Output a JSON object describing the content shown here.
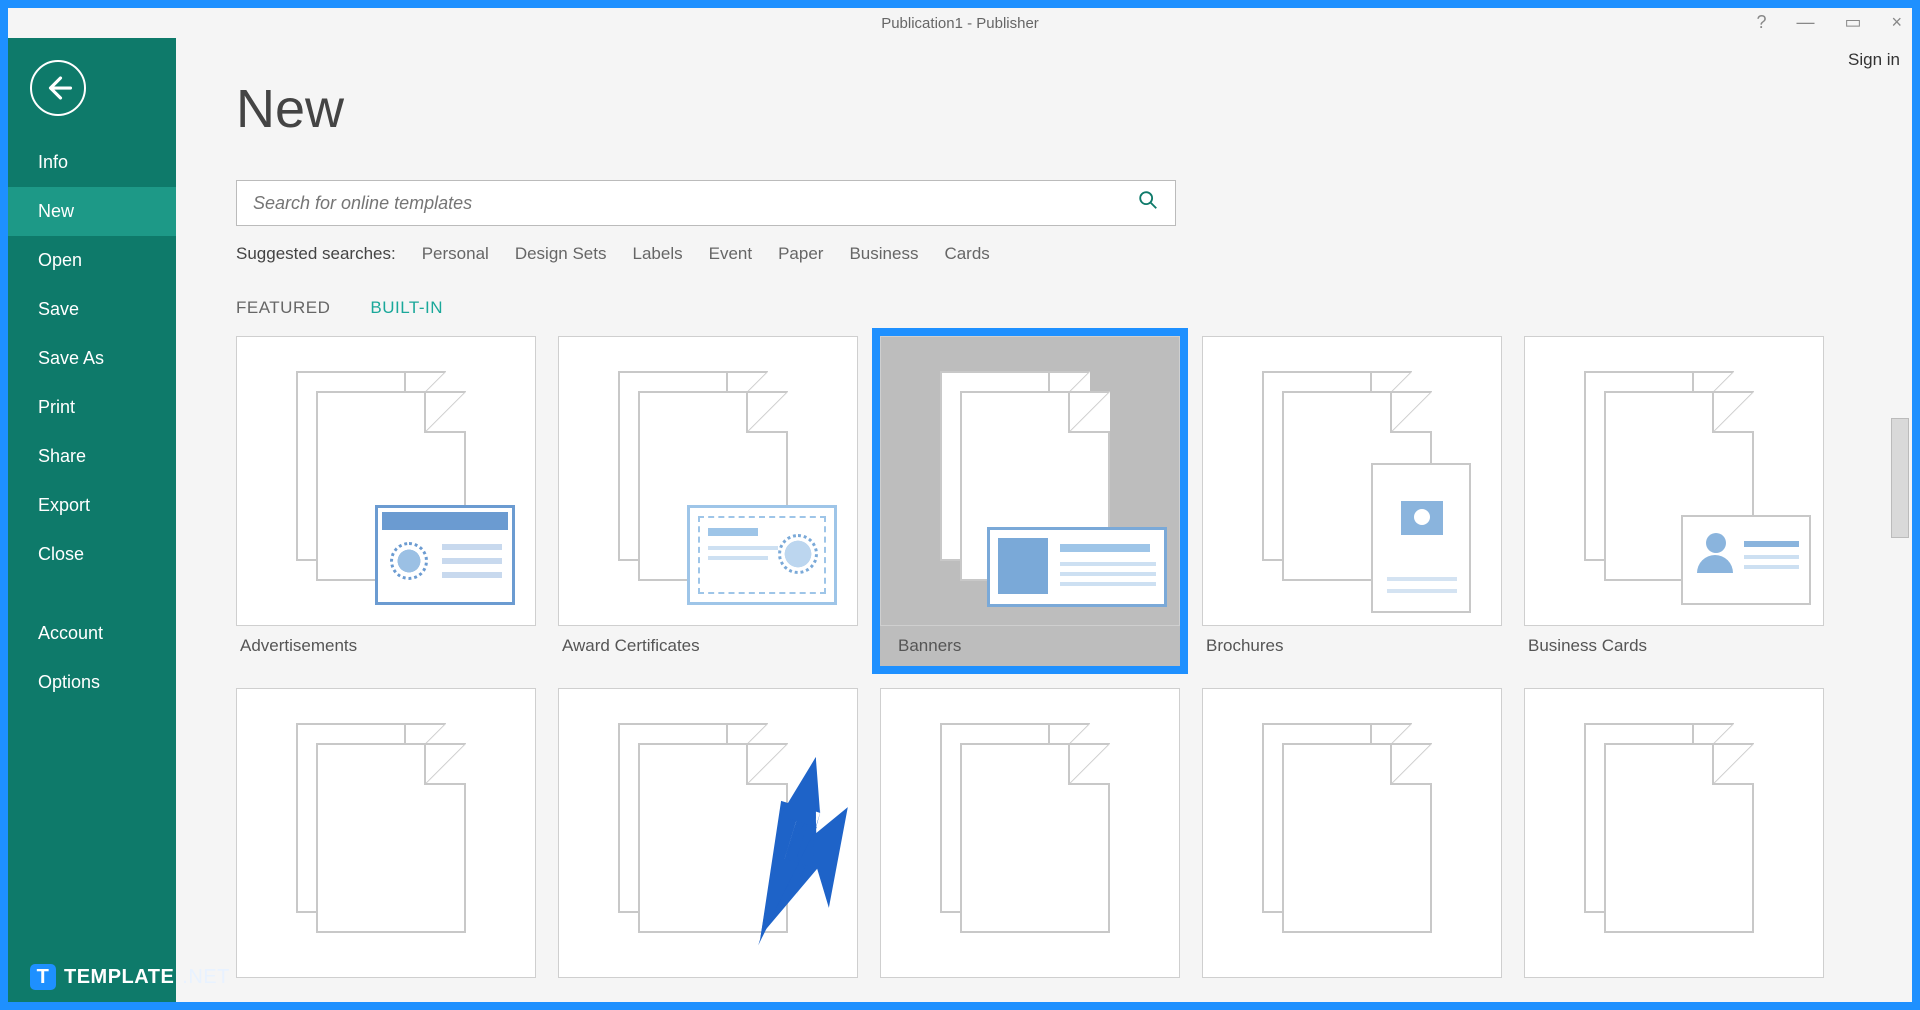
{
  "titlebar": {
    "title": "Publication1 - Publisher"
  },
  "wincontrols": {
    "help": "?",
    "min": "—",
    "restore": "▭",
    "close": "×"
  },
  "signin_label": "Sign in",
  "sidebar": {
    "items": [
      {
        "label": "Info"
      },
      {
        "label": "New"
      },
      {
        "label": "Open"
      },
      {
        "label": "Save"
      },
      {
        "label": "Save As"
      },
      {
        "label": "Print"
      },
      {
        "label": "Share"
      },
      {
        "label": "Export"
      },
      {
        "label": "Close"
      }
    ],
    "bottom_items": [
      {
        "label": "Account"
      },
      {
        "label": "Options"
      }
    ],
    "active_index": 1
  },
  "page": {
    "title": "New"
  },
  "search": {
    "placeholder": "Search for online templates"
  },
  "suggested": {
    "label": "Suggested searches:",
    "items": [
      "Personal",
      "Design Sets",
      "Labels",
      "Event",
      "Paper",
      "Business",
      "Cards"
    ]
  },
  "tabs": {
    "items": [
      "FEATURED",
      "BUILT-IN"
    ],
    "active_index": 1
  },
  "templates_row1": [
    {
      "label": "Advertisements",
      "icon": "ad"
    },
    {
      "label": "Award Certificates",
      "icon": "cert"
    },
    {
      "label": "Banners",
      "icon": "banner",
      "selected": true
    },
    {
      "label": "Brochures",
      "icon": "broch"
    },
    {
      "label": "Business Cards",
      "icon": "biz"
    }
  ],
  "watermark": {
    "brand1": "TEMPLATE",
    "brand2": ".NET"
  }
}
